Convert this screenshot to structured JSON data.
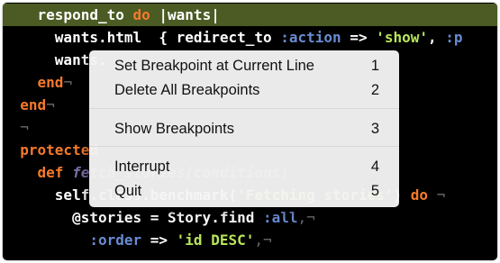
{
  "editor": {
    "lines": [
      [
        {
          "t": "    respond_to ",
          "c": "t"
        },
        {
          "t": "do",
          "c": "kw"
        },
        {
          "t": " |wants|",
          "c": "t"
        }
      ],
      [
        {
          "t": "      wants.html  { redirect_to ",
          "c": "t"
        },
        {
          "t": ":action",
          "c": "sym"
        },
        {
          "t": " => ",
          "c": "t"
        },
        {
          "t": "'show'",
          "c": "str"
        },
        {
          "t": ", ",
          "c": "t"
        },
        {
          "t": ":p",
          "c": "sym"
        }
      ],
      [
        {
          "t": "      wants.",
          "c": "t"
        }
      ],
      [
        {
          "t": "    end",
          "c": "kw"
        },
        {
          "t": "¬",
          "c": "nl"
        }
      ],
      [
        {
          "t": "  end",
          "c": "kw"
        },
        {
          "t": "¬",
          "c": "nl"
        }
      ],
      [
        {
          "t": "  ¬",
          "c": "nl"
        }
      ],
      [
        {
          "t": "  protected",
          "c": "kw"
        }
      ],
      [
        {
          "t": "    def ",
          "c": "kw"
        },
        {
          "t": "fetch_stories(conditions)",
          "c": "cmt"
        }
      ],
      [
        {
          "t": "      self.class.benchmark(",
          "c": "t"
        },
        {
          "t": "'Fetching stories'",
          "c": "str"
        },
        {
          "t": ") ",
          "c": "t"
        },
        {
          "t": "do",
          "c": "kw"
        },
        {
          "t": " ¬",
          "c": "nl"
        }
      ],
      [
        {
          "t": "        @stories = Story.find ",
          "c": "t"
        },
        {
          "t": ":all",
          "c": "sym"
        },
        {
          "t": ",¬",
          "c": "nl"
        }
      ],
      [
        {
          "t": "          ",
          "c": "t"
        },
        {
          "t": ":order",
          "c": "sym"
        },
        {
          "t": " => ",
          "c": "t"
        },
        {
          "t": "'id DESC'",
          "c": "str"
        },
        {
          "t": ",¬",
          "c": "nl"
        }
      ]
    ]
  },
  "context_menu": {
    "groups": [
      [
        {
          "label": "Set Breakpoint at Current Line",
          "shortcut": "1"
        },
        {
          "label": "Delete All Breakpoints",
          "shortcut": "2"
        }
      ],
      [
        {
          "label": "Show Breakpoints",
          "shortcut": "3"
        }
      ],
      [
        {
          "label": "Interrupt",
          "shortcut": "4"
        },
        {
          "label": "Quit",
          "shortcut": "5"
        }
      ]
    ]
  },
  "colors": {
    "background": "#000000",
    "current_line_highlight": "#4b5b23",
    "keyword": "#f57a2a",
    "symbol": "#6a8bd2",
    "string": "#b8e65a",
    "newline_marker": "#6a6a6a",
    "menu_background": "#f5f5f5"
  }
}
